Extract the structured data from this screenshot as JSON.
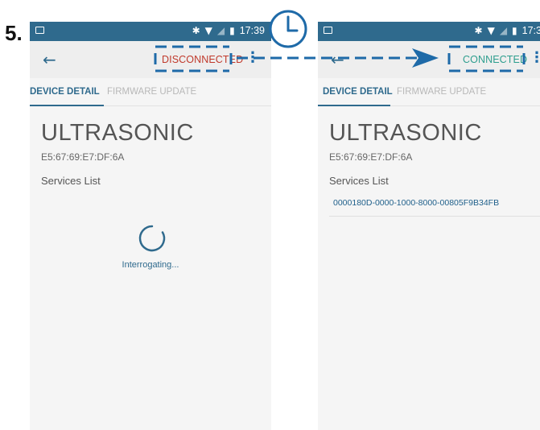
{
  "step": {
    "number": "5."
  },
  "left_screen": {
    "status_bar": {
      "time": "17:39"
    },
    "connection_status": "DISCONNECTED",
    "connection_color": "#c0392b",
    "tabs": [
      {
        "label": "DEVICE DETAIL",
        "active": true
      },
      {
        "label": "FIRMWARE UPDATE",
        "active": false
      }
    ],
    "device": {
      "name": "ULTRASONIC",
      "address": "E5:67:69:E7:DF:6A"
    },
    "services_label": "Services List",
    "loading_text": "Interrogating..."
  },
  "right_screen": {
    "status_bar": {
      "time": "17:3"
    },
    "connection_status": "CONNECTED",
    "connection_color": "#2e9e8e",
    "tabs": [
      {
        "label": "DEVICE DETAIL",
        "active": true
      },
      {
        "label": "FIRMWARE UPDATE",
        "active": false
      }
    ],
    "device": {
      "name": "ULTRASONIC",
      "address": "E5:67:69:E7:DF:6A"
    },
    "services_label": "Services List",
    "services": [
      "0000180D-0000-1000-8000-00805F9B34FB"
    ]
  },
  "colors": {
    "accent": "#2f6a8d",
    "annotation": "#1e6aa8"
  },
  "icons": {
    "back": "arrow-left-icon",
    "menu": "more-vert-icon",
    "clock": "clock-icon",
    "spinner": "loading-spinner-icon"
  }
}
